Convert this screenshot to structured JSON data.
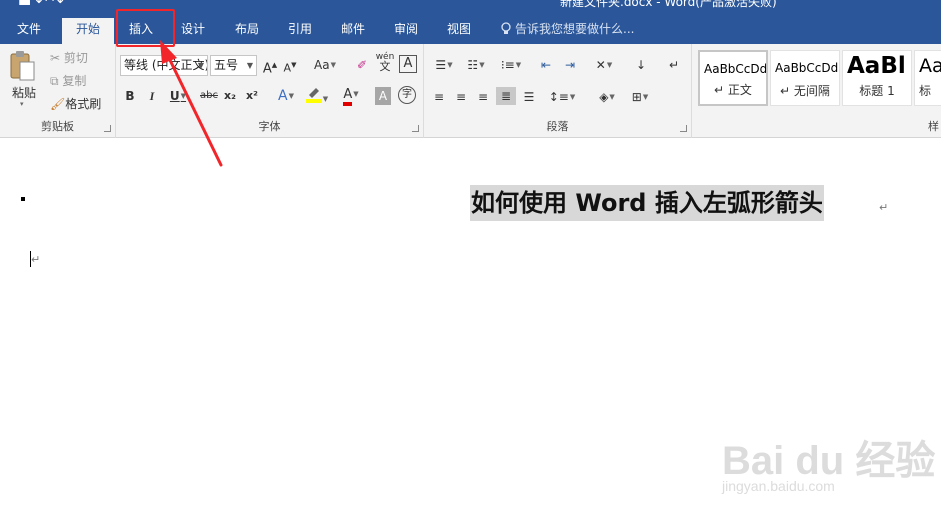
{
  "window": {
    "title": "新建文件夹.docx - Word(产品激活失败)"
  },
  "tabs": [
    {
      "label": "文件"
    },
    {
      "label": "开始"
    },
    {
      "label": "插入"
    },
    {
      "label": "设计"
    },
    {
      "label": "布局"
    },
    {
      "label": "引用"
    },
    {
      "label": "邮件"
    },
    {
      "label": "审阅"
    },
    {
      "label": "视图"
    }
  ],
  "tell_me": {
    "label": "告诉我您想要做什么..."
  },
  "clipboard": {
    "paste_label": "粘贴",
    "cut_label": "剪切",
    "copy_label": "复制",
    "format_painter_label": "格式刷",
    "group_label": "剪贴板"
  },
  "font": {
    "font_name": "等线 (中文正文)",
    "font_size": "五号",
    "bold": "B",
    "italic": "I",
    "underline": "U",
    "strike": "abc",
    "subscript": "x₂",
    "superscript": "x²",
    "change_case": "Aa",
    "phonetic": "wén",
    "phonetic_sub": "文",
    "border_char": "A",
    "effects": "A",
    "font_color": "A",
    "char_shading": "A",
    "enclose": "字",
    "grow": "A",
    "shrink": "A",
    "group_label": "字体"
  },
  "paragraph": {
    "group_label": "段落"
  },
  "styles": [
    {
      "sample": "AaBbCcDd",
      "name": "正文"
    },
    {
      "sample": "AaBbCcDd",
      "name": "无间隔"
    },
    {
      "sample": "AaBl",
      "name": "标题 1"
    },
    {
      "sample": "AaB",
      "name": "标"
    }
  ],
  "styles_group_label": "样",
  "document": {
    "title_text": "如何使用 Word 插入左弧形箭头",
    "para_mark": "↵"
  },
  "watermark": {
    "brand": "Bai du 经验",
    "url": "jingyan.baidu.com"
  },
  "colors": {
    "accent": "#2b579a",
    "highlight": "#f2262a"
  }
}
